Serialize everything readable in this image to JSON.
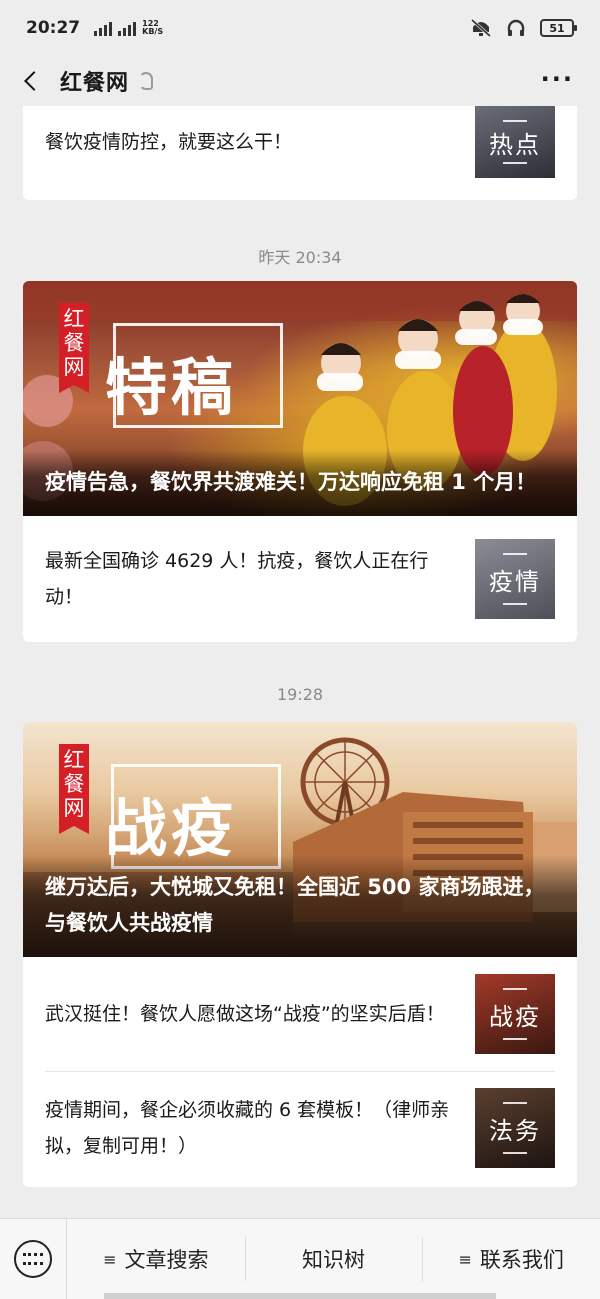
{
  "status_bar": {
    "time": "20:27",
    "network_label": "4G",
    "speed": "122",
    "speed_unit": "KB/S",
    "battery": "51"
  },
  "nav": {
    "title": "红餐网"
  },
  "top_card": {
    "text": "餐饮疫情防控，就要这么干！",
    "thumb_label": "热点"
  },
  "group1": {
    "timestamp": "昨天 20:34",
    "hero": {
      "badge": "红餐网",
      "overlay": "特稿",
      "caption": "疫情告急，餐饮界共渡难关！万达响应免租 1 个月！"
    },
    "items": [
      {
        "text": "最新全国确诊 4629 人！抗疫，餐饮人正在行动！",
        "thumb_label": "疫情"
      }
    ]
  },
  "group2": {
    "timestamp": "19:28",
    "hero": {
      "badge": "红餐网",
      "overlay": "战疫",
      "caption": "继万达后，大悦城又免租！全国近 500 家商场跟进，与餐饮人共战疫情"
    },
    "items": [
      {
        "text": "武汉挺住！餐饮人愿做这场“战疫”的坚实后盾！",
        "thumb_label": "战疫"
      },
      {
        "text": "疫情期间，餐企必须收藏的 6 套模板！（律师亲拟，复制可用！）",
        "thumb_label": "法务"
      }
    ]
  },
  "bottom_menu": {
    "item1": "文章搜索",
    "item2": "知识树",
    "item3": "联系我们"
  }
}
